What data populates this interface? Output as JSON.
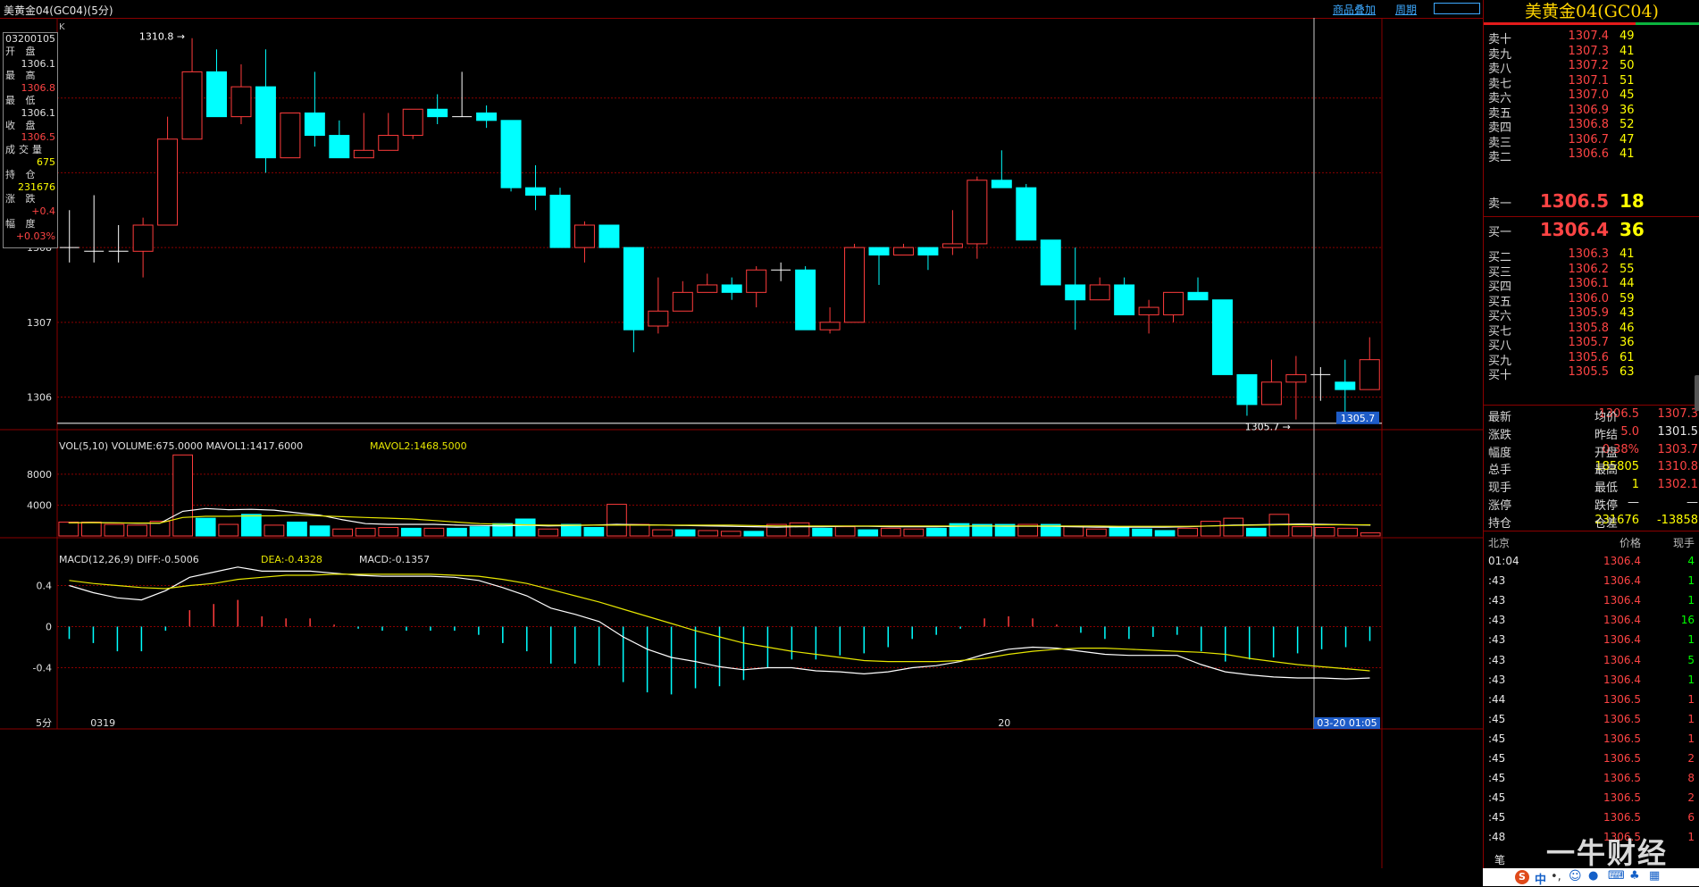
{
  "window": {
    "title": "美黄金04(GC04)(5分)",
    "overlay_btn": "商品叠加",
    "period_btn": "周期"
  },
  "info": {
    "date": "03200105",
    "rows": [
      {
        "label": "开 盘",
        "value": "1306.1",
        "color": "#e0e0e0"
      },
      {
        "label": "最 高",
        "value": "1306.8",
        "color": "#ff4444"
      },
      {
        "label": "最 低",
        "value": "1306.1",
        "color": "#e0e0e0"
      },
      {
        "label": "收 盘",
        "value": "1306.5",
        "color": "#ff4444"
      },
      {
        "label": "成交量",
        "value": "675",
        "color": "#ffff00"
      },
      {
        "label": "持 仓",
        "value": "231676",
        "color": "#ffff00"
      },
      {
        "label": "涨 跌",
        "value": "+0.4",
        "color": "#ff4444"
      },
      {
        "label": "幅 度",
        "value": "+0.03%",
        "color": "#ff4444"
      }
    ]
  },
  "chart_data": {
    "type": "candlestick",
    "period": "5分",
    "candles": [
      {
        "o": 1308.0,
        "c": 1308.0,
        "h": 1308.5,
        "l": 1307.8
      },
      {
        "o": 1307.95,
        "c": 1307.95,
        "h": 1308.7,
        "l": 1307.8
      },
      {
        "o": 1307.95,
        "c": 1307.95,
        "h": 1308.3,
        "l": 1307.8
      },
      {
        "o": 1307.95,
        "c": 1308.3,
        "h": 1308.4,
        "l": 1307.6
      },
      {
        "o": 1308.3,
        "c": 1309.45,
        "h": 1309.75,
        "l": 1308.3
      },
      {
        "o": 1309.45,
        "c": 1310.35,
        "h": 1310.8,
        "l": 1309.45
      },
      {
        "o": 1310.35,
        "c": 1309.75,
        "h": 1310.65,
        "l": 1309.75
      },
      {
        "o": 1309.75,
        "c": 1310.15,
        "h": 1310.45,
        "l": 1309.65
      },
      {
        "o": 1310.15,
        "c": 1309.2,
        "h": 1310.65,
        "l": 1309.0
      },
      {
        "o": 1309.2,
        "c": 1309.8,
        "h": 1309.8,
        "l": 1309.2
      },
      {
        "o": 1309.8,
        "c": 1309.5,
        "h": 1310.35,
        "l": 1309.35
      },
      {
        "o": 1309.5,
        "c": 1309.2,
        "h": 1309.7,
        "l": 1309.2
      },
      {
        "o": 1309.2,
        "c": 1309.3,
        "h": 1309.8,
        "l": 1309.2
      },
      {
        "o": 1309.3,
        "c": 1309.5,
        "h": 1309.8,
        "l": 1309.3
      },
      {
        "o": 1309.5,
        "c": 1309.85,
        "h": 1309.85,
        "l": 1309.45
      },
      {
        "o": 1309.85,
        "c": 1309.75,
        "h": 1310.05,
        "l": 1309.65
      },
      {
        "o": 1309.75,
        "c": 1309.75,
        "h": 1310.35,
        "l": 1309.75
      },
      {
        "o": 1309.8,
        "c": 1309.7,
        "h": 1309.9,
        "l": 1309.6
      },
      {
        "o": 1309.7,
        "c": 1308.8,
        "h": 1309.7,
        "l": 1308.75
      },
      {
        "o": 1308.8,
        "c": 1308.7,
        "h": 1309.1,
        "l": 1308.5
      },
      {
        "o": 1308.7,
        "c": 1308.0,
        "h": 1308.8,
        "l": 1308.0
      },
      {
        "o": 1308.0,
        "c": 1308.3,
        "h": 1308.35,
        "l": 1307.8
      },
      {
        "o": 1308.3,
        "c": 1308.0,
        "h": 1308.3,
        "l": 1308.0
      },
      {
        "o": 1308.0,
        "c": 1306.9,
        "h": 1308.0,
        "l": 1306.6
      },
      {
        "o": 1306.95,
        "c": 1307.15,
        "h": 1307.6,
        "l": 1306.85
      },
      {
        "o": 1307.15,
        "c": 1307.4,
        "h": 1307.55,
        "l": 1307.15
      },
      {
        "o": 1307.4,
        "c": 1307.5,
        "h": 1307.65,
        "l": 1307.4
      },
      {
        "o": 1307.5,
        "c": 1307.4,
        "h": 1307.6,
        "l": 1307.3
      },
      {
        "o": 1307.4,
        "c": 1307.7,
        "h": 1307.75,
        "l": 1307.2
      },
      {
        "o": 1307.7,
        "c": 1307.7,
        "h": 1307.8,
        "l": 1307.55
      },
      {
        "o": 1307.7,
        "c": 1306.9,
        "h": 1307.75,
        "l": 1306.9
      },
      {
        "o": 1306.9,
        "c": 1307.0,
        "h": 1307.2,
        "l": 1306.85
      },
      {
        "o": 1307.0,
        "c": 1308.0,
        "h": 1308.05,
        "l": 1307.0
      },
      {
        "o": 1308.0,
        "c": 1307.9,
        "h": 1308.0,
        "l": 1307.5
      },
      {
        "o": 1307.9,
        "c": 1308.0,
        "h": 1308.05,
        "l": 1307.9
      },
      {
        "o": 1308.0,
        "c": 1307.9,
        "h": 1308.0,
        "l": 1307.7
      },
      {
        "o": 1308.0,
        "c": 1308.05,
        "h": 1308.5,
        "l": 1307.9
      },
      {
        "o": 1308.05,
        "c": 1308.9,
        "h": 1308.95,
        "l": 1307.85
      },
      {
        "o": 1308.9,
        "c": 1308.8,
        "h": 1309.3,
        "l": 1308.8
      },
      {
        "o": 1308.8,
        "c": 1308.1,
        "h": 1308.85,
        "l": 1308.1
      },
      {
        "o": 1308.1,
        "c": 1307.5,
        "h": 1308.1,
        "l": 1307.5
      },
      {
        "o": 1307.5,
        "c": 1307.3,
        "h": 1308.0,
        "l": 1306.9
      },
      {
        "o": 1307.3,
        "c": 1307.5,
        "h": 1307.6,
        "l": 1307.3
      },
      {
        "o": 1307.5,
        "c": 1307.1,
        "h": 1307.6,
        "l": 1307.1
      },
      {
        "o": 1307.1,
        "c": 1307.2,
        "h": 1307.3,
        "l": 1306.85
      },
      {
        "o": 1307.1,
        "c": 1307.4,
        "h": 1307.4,
        "l": 1307.0
      },
      {
        "o": 1307.4,
        "c": 1307.3,
        "h": 1307.6,
        "l": 1307.3
      },
      {
        "o": 1307.3,
        "c": 1306.3,
        "h": 1307.3,
        "l": 1306.3
      },
      {
        "o": 1306.3,
        "c": 1305.9,
        "h": 1306.3,
        "l": 1305.75
      },
      {
        "o": 1305.9,
        "c": 1306.2,
        "h": 1306.5,
        "l": 1305.9
      },
      {
        "o": 1306.2,
        "c": 1306.3,
        "h": 1306.55,
        "l": 1305.7
      },
      {
        "o": 1306.3,
        "c": 1306.3,
        "h": 1306.4,
        "l": 1305.95
      },
      {
        "o": 1306.2,
        "c": 1306.1,
        "h": 1306.5,
        "l": 1305.8
      },
      {
        "o": 1306.1,
        "c": 1306.5,
        "h": 1306.8,
        "l": 1306.1
      }
    ],
    "price_ylim": [
      1305.6,
      1311.0
    ],
    "price_ticks": [
      1306,
      1307,
      1308
    ],
    "max_label": "1310.8",
    "min_label": "1305.7",
    "last_price_label": "1305.7",
    "volume": {
      "legend": "VOL(5,10) VOLUME:675.0000",
      "mavol1_label": "MAVOL1:1417.6000",
      "mavol2_label": "MAVOL2:1468.5000",
      "ticks": [
        4000,
        8000
      ],
      "ylim": [
        0,
        11000
      ],
      "values": [
        1800,
        1800,
        1500,
        1400,
        1900,
        10500,
        2300,
        1500,
        2800,
        1400,
        1800,
        1300,
        900,
        1000,
        1100,
        1000,
        1000,
        1000,
        1200,
        1600,
        2200,
        900,
        1500,
        1100,
        4100,
        1500,
        800,
        800,
        700,
        600,
        600,
        1500,
        1700,
        1000,
        1200,
        800,
        1000,
        900,
        1000,
        1600,
        1500,
        1500,
        1500,
        1500,
        1200,
        900,
        1100,
        900,
        700,
        1000,
        1900,
        2300,
        1000,
        2800,
        1200,
        1100,
        1000,
        400
      ],
      "mavol1": [
        1700,
        1750,
        1700,
        1650,
        1650,
        3200,
        3550,
        3400,
        3450,
        3350,
        3000,
        2700,
        2100,
        1600,
        1500,
        1500,
        1500,
        1400,
        1350,
        1300,
        1400,
        1300,
        1350,
        1400,
        1500,
        1450,
        1400,
        1350,
        1300,
        1250,
        1200,
        1150,
        1200,
        1200,
        1250,
        1250,
        1200,
        1200,
        1200,
        1250,
        1300,
        1250,
        1250,
        1250,
        1200,
        1150,
        1150,
        1150,
        1150,
        1200,
        1300,
        1400,
        1450,
        1500,
        1550,
        1500,
        1450,
        1400
      ],
      "mavol2": [
        1700,
        1720,
        1700,
        1680,
        1680,
        2400,
        2550,
        2550,
        2600,
        2600,
        2700,
        2600,
        2500,
        2400,
        2300,
        2200,
        2000,
        1800,
        1600,
        1500,
        1450,
        1400,
        1400,
        1400,
        1400,
        1400,
        1400,
        1400,
        1400,
        1400,
        1350,
        1300,
        1300,
        1300,
        1300,
        1300,
        1300,
        1300,
        1300,
        1300,
        1300,
        1300,
        1300,
        1300,
        1300,
        1300,
        1250,
        1250,
        1250,
        1250,
        1300,
        1350,
        1400,
        1450,
        1450,
        1450,
        1450,
        1450
      ]
    },
    "macd": {
      "legend": "MACD(12,26,9)",
      "diff_label": "DIFF:-0.5006",
      "dea_label": "DEA:-0.4328",
      "macd_label": "MACD:-0.1357",
      "ticks": [
        0.4,
        0,
        -0.4
      ],
      "ylim": [
        -0.9,
        0.7
      ],
      "diff": [
        0.4,
        0.33,
        0.28,
        0.26,
        0.35,
        0.48,
        0.53,
        0.58,
        0.54,
        0.54,
        0.54,
        0.52,
        0.5,
        0.49,
        0.49,
        0.49,
        0.48,
        0.45,
        0.38,
        0.3,
        0.18,
        0.12,
        0.05,
        -0.1,
        -0.22,
        -0.3,
        -0.34,
        -0.39,
        -0.42,
        -0.4,
        -0.4,
        -0.43,
        -0.44,
        -0.46,
        -0.44,
        -0.4,
        -0.38,
        -0.34,
        -0.27,
        -0.22,
        -0.2,
        -0.21,
        -0.24,
        -0.27,
        -0.28,
        -0.28,
        -0.28,
        -0.37,
        -0.44,
        -0.47,
        -0.49,
        -0.5,
        -0.5,
        -0.51,
        -0.5
      ],
      "dea": [
        0.45,
        0.42,
        0.4,
        0.38,
        0.37,
        0.4,
        0.42,
        0.46,
        0.48,
        0.5,
        0.5,
        0.51,
        0.51,
        0.51,
        0.51,
        0.51,
        0.5,
        0.49,
        0.46,
        0.42,
        0.36,
        0.3,
        0.24,
        0.17,
        0.1,
        0.03,
        -0.04,
        -0.1,
        -0.16,
        -0.2,
        -0.24,
        -0.27,
        -0.3,
        -0.33,
        -0.34,
        -0.34,
        -0.34,
        -0.33,
        -0.31,
        -0.27,
        -0.24,
        -0.22,
        -0.21,
        -0.21,
        -0.22,
        -0.23,
        -0.24,
        -0.25,
        -0.27,
        -0.31,
        -0.34,
        -0.37,
        -0.39,
        -0.41,
        -0.43
      ],
      "hist": [
        -0.12,
        -0.16,
        -0.24,
        -0.24,
        -0.04,
        0.16,
        0.22,
        0.26,
        0.1,
        0.08,
        0.08,
        0.02,
        -0.02,
        -0.04,
        -0.04,
        -0.04,
        -0.04,
        -0.08,
        -0.16,
        -0.24,
        -0.36,
        -0.36,
        -0.38,
        -0.54,
        -0.64,
        -0.66,
        -0.6,
        -0.58,
        -0.52,
        -0.4,
        -0.32,
        -0.32,
        -0.28,
        -0.26,
        -0.2,
        -0.12,
        -0.08,
        -0.02,
        0.08,
        0.1,
        0.08,
        0.02,
        -0.06,
        -0.12,
        -0.12,
        -0.1,
        -0.08,
        -0.24,
        -0.34,
        -0.32,
        -0.3,
        -0.26,
        -0.22,
        -0.2,
        -0.14
      ]
    },
    "x_labels": [
      {
        "idx": 1,
        "text": "0319"
      },
      {
        "idx": 38,
        "text": "20"
      }
    ],
    "cursor_time": "03-20 01:05",
    "period_label": "5分"
  },
  "orderbook": {
    "title": "美黄金04(GC04)",
    "asks": [
      {
        "label": "卖十",
        "price": "1307.4",
        "qty": "49"
      },
      {
        "label": "卖九",
        "price": "1307.3",
        "qty": "41"
      },
      {
        "label": "卖八",
        "price": "1307.2",
        "qty": "50"
      },
      {
        "label": "卖七",
        "price": "1307.1",
        "qty": "51"
      },
      {
        "label": "卖六",
        "price": "1307.0",
        "qty": "45"
      },
      {
        "label": "卖五",
        "price": "1306.9",
        "qty": "36"
      },
      {
        "label": "卖四",
        "price": "1306.8",
        "qty": "52"
      },
      {
        "label": "卖三",
        "price": "1306.7",
        "qty": "47"
      },
      {
        "label": "卖二",
        "price": "1306.6",
        "qty": "41"
      },
      {
        "label": "卖一",
        "price": "1306.5",
        "qty": "18"
      }
    ],
    "bids": [
      {
        "label": "买一",
        "price": "1306.4",
        "qty": "36"
      },
      {
        "label": "买二",
        "price": "1306.3",
        "qty": "41"
      },
      {
        "label": "买三",
        "price": "1306.2",
        "qty": "55"
      },
      {
        "label": "买四",
        "price": "1306.1",
        "qty": "44"
      },
      {
        "label": "买五",
        "price": "1306.0",
        "qty": "59"
      },
      {
        "label": "买六",
        "price": "1305.9",
        "qty": "43"
      },
      {
        "label": "买七",
        "price": "1305.8",
        "qty": "46"
      },
      {
        "label": "买八",
        "price": "1305.7",
        "qty": "36"
      },
      {
        "label": "买九",
        "price": "1305.6",
        "qty": "61"
      },
      {
        "label": "买十",
        "price": "1305.5",
        "qty": "63"
      }
    ]
  },
  "stats": [
    {
      "l1": "最新",
      "v1": "1306.5",
      "c1": "#ff4444",
      "l2": "均价",
      "v2": "1307.3",
      "c2": "#ff4444"
    },
    {
      "l1": "涨跌",
      "v1": "5.0",
      "c1": "#ff4444",
      "l2": "昨结",
      "v2": "1301.5",
      "c2": "#e6e6e6"
    },
    {
      "l1": "幅度",
      "v1": "0.38%",
      "c1": "#ff4444",
      "l2": "开盘",
      "v2": "1303.7",
      "c2": "#ff4444"
    },
    {
      "l1": "总手",
      "v1": "185805",
      "c1": "#ffff00",
      "l2": "最高",
      "v2": "1310.8",
      "c2": "#ff4444"
    },
    {
      "l1": "现手",
      "v1": "1",
      "c1": "#ffff00",
      "l2": "最低",
      "v2": "1302.1",
      "c2": "#ff4444"
    },
    {
      "l1": "涨停",
      "v1": "—",
      "c1": "#e6e6e6",
      "l2": "跌停",
      "v2": "—",
      "c2": "#e6e6e6"
    },
    {
      "l1": "持仓",
      "v1": "231676",
      "c1": "#ffff00",
      "l2": "仓差",
      "v2": "-13858",
      "c2": "#ffff00"
    }
  ],
  "ticks": {
    "header": {
      "time": "北京",
      "price": "价格",
      "vol": "现手"
    },
    "rows": [
      {
        "t": "01:04",
        "p": "1306.4",
        "v": "4",
        "c": "#00ff00"
      },
      {
        "t": ":43",
        "p": "1306.4",
        "v": "1",
        "c": "#00ff00"
      },
      {
        "t": ":43",
        "p": "1306.4",
        "v": "1",
        "c": "#00ff00"
      },
      {
        "t": ":43",
        "p": "1306.4",
        "v": "16",
        "c": "#00ff00"
      },
      {
        "t": ":43",
        "p": "1306.4",
        "v": "1",
        "c": "#00ff00"
      },
      {
        "t": ":43",
        "p": "1306.4",
        "v": "5",
        "c": "#00ff00"
      },
      {
        "t": ":43",
        "p": "1306.4",
        "v": "1",
        "c": "#00ff00"
      },
      {
        "t": ":44",
        "p": "1306.5",
        "v": "1",
        "c": "#ff4444"
      },
      {
        "t": ":45",
        "p": "1306.5",
        "v": "1",
        "c": "#ff4444"
      },
      {
        "t": ":45",
        "p": "1306.5",
        "v": "1",
        "c": "#ff4444"
      },
      {
        "t": ":45",
        "p": "1306.5",
        "v": "2",
        "c": "#ff4444"
      },
      {
        "t": ":45",
        "p": "1306.5",
        "v": "8",
        "c": "#ff4444"
      },
      {
        "t": ":45",
        "p": "1306.5",
        "v": "2",
        "c": "#ff4444"
      },
      {
        "t": ":45",
        "p": "1306.5",
        "v": "6",
        "c": "#ff4444"
      },
      {
        "t": ":48",
        "p": "1306.5",
        "v": "1",
        "c": "#ff4444"
      }
    ],
    "footer_label": "笔"
  },
  "watermark": "一牛财经",
  "taskbar": {
    "ime": "中"
  },
  "colors": {
    "up": "#ff3c3c",
    "down": "#00ffff",
    "grid": "#8a0000",
    "mavol1": "#ffffff",
    "mavol2": "#e6e600",
    "diff": "#ffffff",
    "dea": "#e6e600"
  }
}
